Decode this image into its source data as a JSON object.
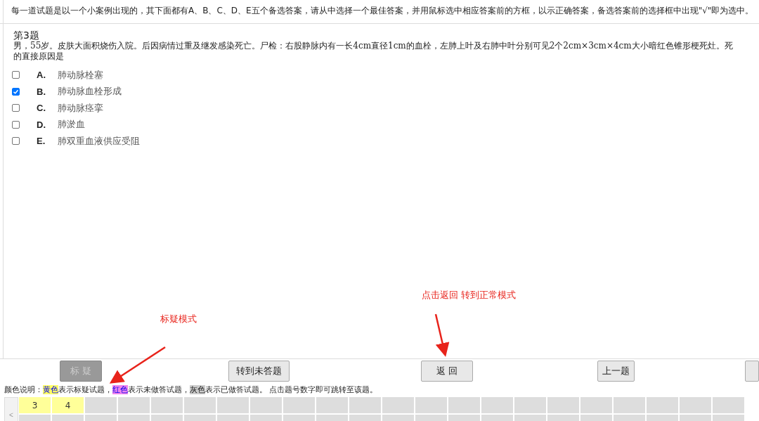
{
  "instruction": "每一道试题是以一个小案例出现的，其下面都有A、B、C、D、E五个备选答案，请从中选择一个最佳答案，并用鼠标选中相应答案前的方框，以示正确答案，备选答案前的选择框中出现\"√\"即为选中。",
  "question": {
    "number": "第3题",
    "lines": [
      "男，55岁。皮肤大面积烧伤入院。后因病情过重及继发感染死亡。尸检：右股静脉内有一长4cm直径1cm的血栓，左肺上叶及右肺中叶分别可见2个2cm×3cm×4cm大小暗红色锥形梗死灶。死",
      "的直接原因是"
    ]
  },
  "options": [
    {
      "letter": "A.",
      "text": "肺动脉栓塞",
      "selected": false
    },
    {
      "letter": "B.",
      "text": "肺动脉血栓形成",
      "selected": true
    },
    {
      "letter": "C.",
      "text": "肺动脉痉挛",
      "selected": false
    },
    {
      "letter": "D.",
      "text": "肺淤血",
      "selected": false
    },
    {
      "letter": "E.",
      "text": "肺双重血液供应受阻",
      "selected": false
    }
  ],
  "annotations": [
    {
      "text": "标疑模式",
      "kind": "left"
    },
    {
      "text": "点击返回 转到正常模式",
      "kind": "right"
    }
  ],
  "buttons": [
    {
      "label": "标 疑",
      "disabled": true
    },
    {
      "label": "转到未答题",
      "disabled": false
    },
    {
      "label": "返 回",
      "disabled": false
    },
    {
      "label": "上一题",
      "disabled": false
    }
  ],
  "legend": [
    {
      "text": "颜色说明：",
      "kind": "plain"
    },
    {
      "text": "黄色",
      "kind": "yellow"
    },
    {
      "text": "表示标疑试题，",
      "kind": "plain"
    },
    {
      "text": "红色",
      "kind": "red"
    },
    {
      "text": "表示未做答试题，",
      "kind": "plain"
    },
    {
      "text": "灰色",
      "kind": "grey"
    },
    {
      "text": "表示已做答试题。 点击题号数字即可跳转至该题。",
      "kind": "plain"
    }
  ],
  "scroll_left": "<",
  "question_cells": [
    {
      "label": "3",
      "color": "#ffff99"
    },
    {
      "label": "4",
      "color": "#ffff99"
    }
  ]
}
